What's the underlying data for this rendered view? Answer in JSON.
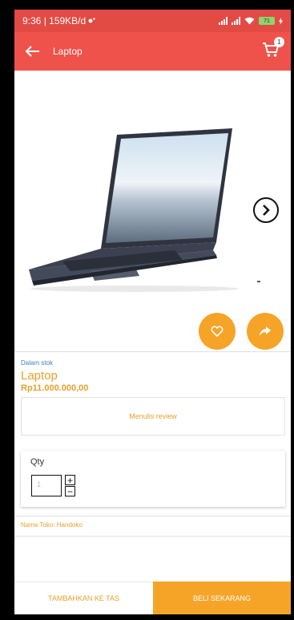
{
  "status_bar": {
    "time_speed": "9:36 | 159KB/d",
    "battery": "71"
  },
  "app_bar": {
    "title": "Laptop",
    "cart_count": "1"
  },
  "product": {
    "stock_status": "Dalam stok",
    "name": "Laptop",
    "price": "Rp11.000.000,00"
  },
  "review": {
    "label": "Menulis review"
  },
  "quantity": {
    "label": "Qty",
    "value": "1",
    "plus": "+",
    "minus": "−"
  },
  "store": {
    "label": "Nama Toko: Handoko"
  },
  "actions": {
    "add_to_bag": "TAMBAHKAN KE TAS",
    "buy_now": "BELI SEKARANG"
  },
  "colors": {
    "status_bar": "#e24a44",
    "app_bar": "#ef524a",
    "accent_orange": "#f6a428",
    "price_text": "#e7a12b",
    "stock_text": "#3f7fc7"
  }
}
